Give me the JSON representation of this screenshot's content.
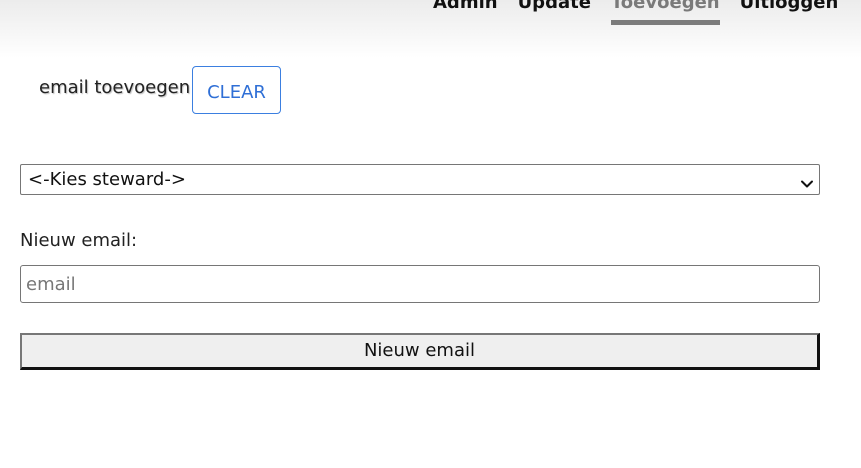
{
  "nav": {
    "items": [
      {
        "label": "Admin",
        "active": false
      },
      {
        "label": "Update",
        "active": false
      },
      {
        "label": "Toevoegen",
        "active": true
      },
      {
        "label": "Uitloggen",
        "active": false
      }
    ]
  },
  "page": {
    "heading": "email toevoegen",
    "clear_label": "CLEAR"
  },
  "form": {
    "steward_select_value": "<-Kies steward->",
    "new_email_label": "Nieuw email:",
    "email_placeholder": "email",
    "email_value": "",
    "submit_label": "Nieuw email"
  },
  "colors": {
    "accent": "#2f6fd6",
    "active_tab": "#7b7b7b"
  }
}
